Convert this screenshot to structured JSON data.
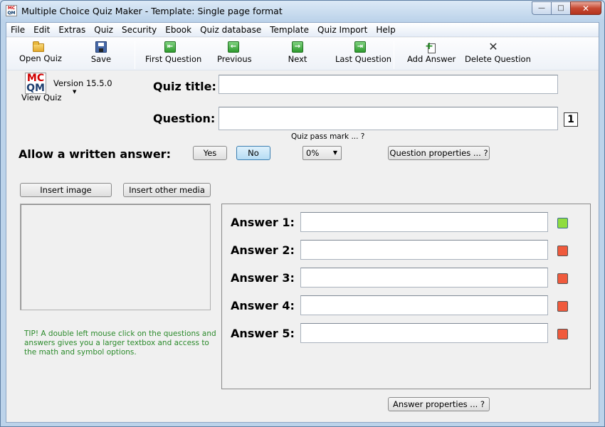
{
  "window": {
    "title": "Multiple Choice Quiz Maker - Template: Single page format",
    "icon_text": [
      "MC",
      "QM"
    ],
    "caption": {
      "minimize": "—",
      "maximize": "□",
      "close": "✕"
    }
  },
  "menu": [
    "File",
    "Edit",
    "Extras",
    "Quiz",
    "Security",
    "Ebook",
    "Quiz database",
    "Template",
    "Quiz Import",
    "Help"
  ],
  "toolbar": {
    "open_quiz": "Open Quiz",
    "save": "Save",
    "first_question": "First Question",
    "previous": "Previous",
    "next": "Next",
    "last_question": "Last Question",
    "add_answer": "Add Answer",
    "delete_question": "Delete Question"
  },
  "logo": {
    "line1": "MC",
    "line2": "QM"
  },
  "version": "Version 15.5.0",
  "view_quiz": "View Quiz",
  "quiz_title": {
    "label": "Quiz title:",
    "value": ""
  },
  "question": {
    "label": "Question:",
    "value": "",
    "number": "1"
  },
  "written_answer": {
    "label": "Allow a written answer:",
    "yes": "Yes",
    "no": "No"
  },
  "pass_mark": {
    "label": "Quiz pass mark ... ?",
    "value": "0%"
  },
  "question_properties": "Question properties ... ?",
  "insert_image": "Insert image",
  "insert_media": "Insert other media",
  "tip": "TIP! A double left mouse click on the questions and answers gives you a larger textbox and access to the math and symbol options.",
  "answers": [
    {
      "label": "Answer 1:",
      "value": "",
      "correct": true
    },
    {
      "label": "Answer 2:",
      "value": "",
      "correct": false
    },
    {
      "label": "Answer 3:",
      "value": "",
      "correct": false
    },
    {
      "label": "Answer 4:",
      "value": "",
      "correct": false
    },
    {
      "label": "Answer 5:",
      "value": "",
      "correct": false
    }
  ],
  "answer_properties": "Answer properties ... ?",
  "colors": {
    "correct": "#8fdc3f",
    "incorrect": "#f05a3c",
    "tip_text": "#2b8a2b"
  }
}
